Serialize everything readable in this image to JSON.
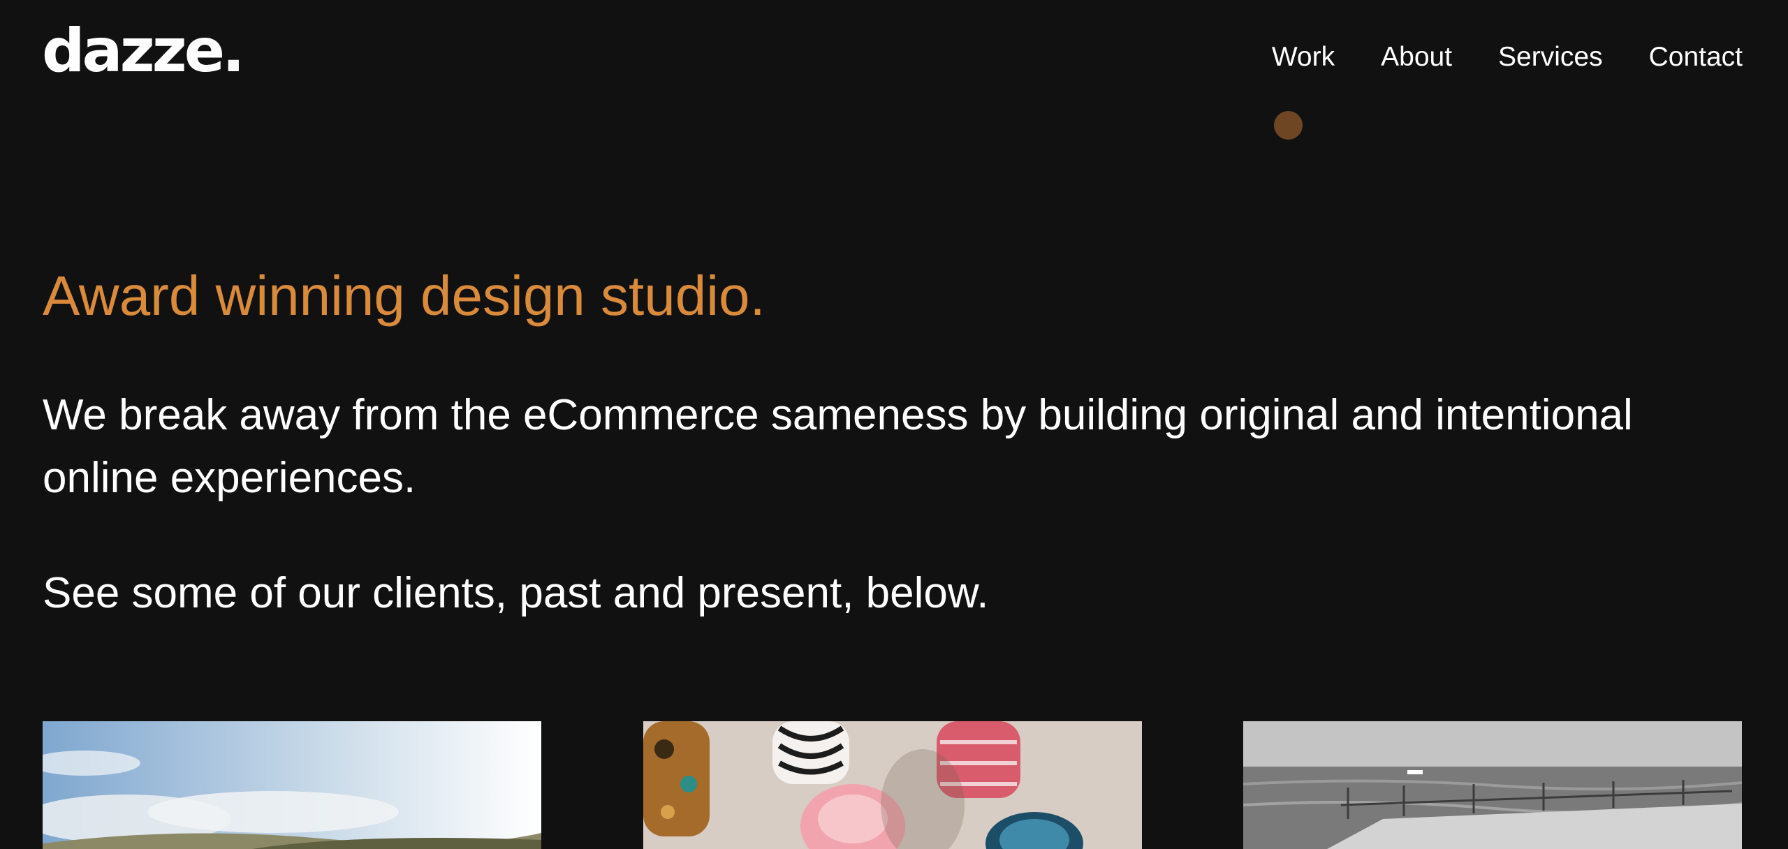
{
  "header": {
    "logo_text": "dazze.",
    "nav": [
      {
        "label": "Work",
        "active": true
      },
      {
        "label": "About"
      },
      {
        "label": "Services"
      },
      {
        "label": "Contact"
      }
    ],
    "active_indicator_color": "#6e4624"
  },
  "hero": {
    "tagline": "Award winning design studio.",
    "intro": "We break away from the eCommerce sameness by building original and intentional online experiences.",
    "cta_text": "See some of our clients, past and present, below."
  },
  "clients": [
    {
      "image": "sky-landscape-photo"
    },
    {
      "image": "glassware-photo"
    },
    {
      "image": "pier-sea-photo"
    }
  ],
  "colors": {
    "background": "#111112",
    "accent": "#d98a3a",
    "text": "#ffffff"
  }
}
